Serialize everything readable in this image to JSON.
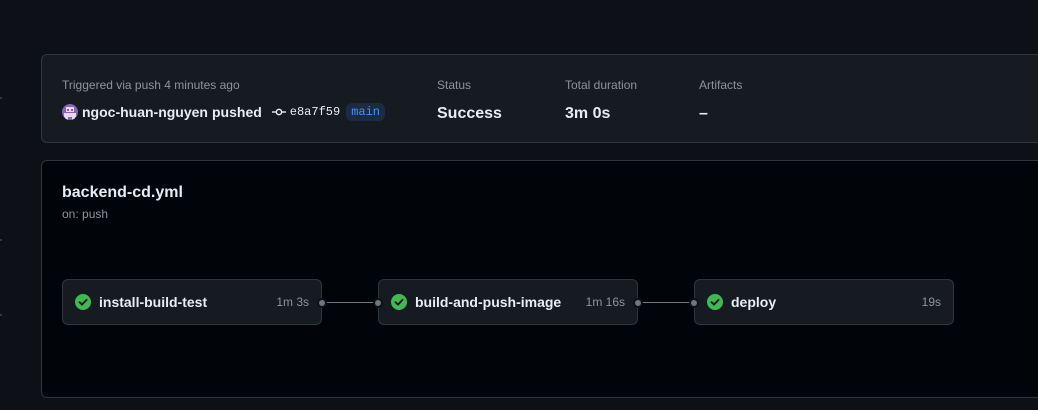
{
  "summary": {
    "trigger_label": "Triggered via push 4 minutes ago",
    "actor": "ngoc-huan-nguyen",
    "action": "pushed",
    "commit_sha": "e8a7f59",
    "branch": "main",
    "status_label": "Status",
    "status_value": "Success",
    "duration_label": "Total duration",
    "duration_value": "3m 0s",
    "artifacts_label": "Artifacts",
    "artifacts_value": "–"
  },
  "workflow": {
    "file": "backend-cd.yml",
    "trigger": "on: push",
    "jobs": [
      {
        "name": "install-build-test",
        "duration": "1m 3s",
        "status": "success"
      },
      {
        "name": "build-and-push-image",
        "duration": "1m 16s",
        "status": "success"
      },
      {
        "name": "deploy",
        "duration": "19s",
        "status": "success"
      }
    ]
  },
  "colors": {
    "success": "#3fb950",
    "accent": "#4493f8",
    "background": "#0d1117",
    "canvas": "#010409"
  },
  "icons": {
    "status": "check-circle-icon",
    "commit": "git-commit-icon"
  }
}
